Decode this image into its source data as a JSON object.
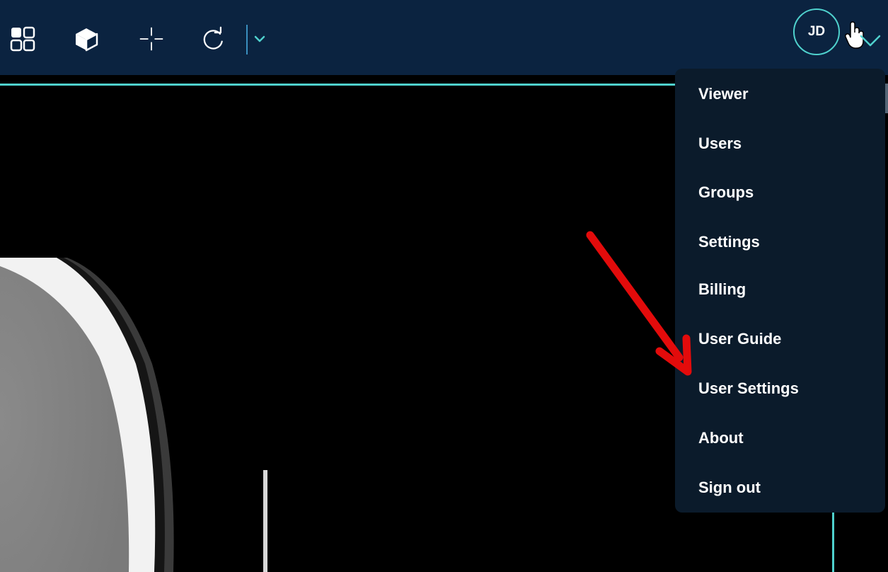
{
  "toolbar": {
    "icons": [
      "layout-grid-icon",
      "cube-icon",
      "crosshair-icon",
      "rotate-icon",
      "chevron-down-icon"
    ],
    "accent_color": "#4fd1cd",
    "background_color": "#0b2340"
  },
  "user": {
    "initials": "JD"
  },
  "user_menu": {
    "items": [
      {
        "label": "Viewer"
      },
      {
        "label": "Users"
      },
      {
        "label": "Groups"
      },
      {
        "label": "Settings"
      },
      {
        "label": "Billing"
      },
      {
        "label": "User Guide"
      },
      {
        "label": "User Settings"
      },
      {
        "label": "About"
      },
      {
        "label": "Sign out"
      }
    ],
    "background_color": "#0b1b2b"
  },
  "annotation": {
    "arrow_color": "#e30b0b",
    "points_to": "User Settings"
  }
}
